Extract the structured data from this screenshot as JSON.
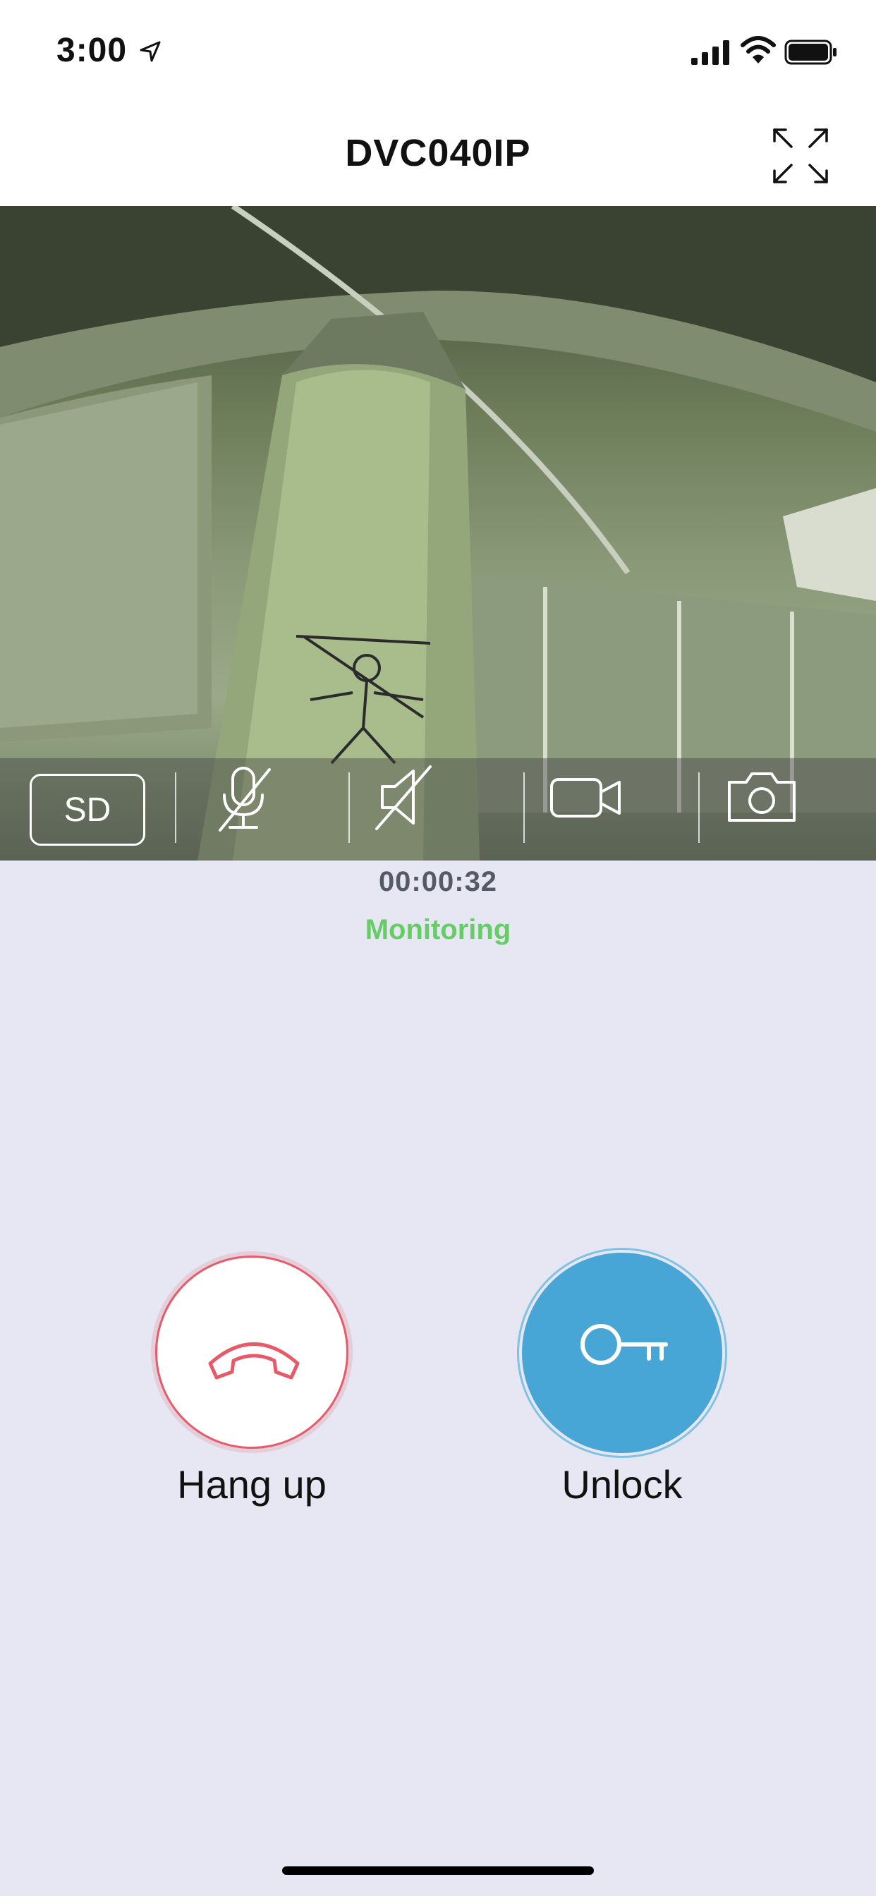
{
  "status_bar": {
    "time": "3:00",
    "icons": [
      "location-arrow-icon",
      "cellular-signal-icon",
      "wifi-icon",
      "battery-icon"
    ]
  },
  "header": {
    "title": "DVC040IP",
    "fullscreen_icon": "expand-icon"
  },
  "video": {
    "description_icon": "camera-feed",
    "toolbar": {
      "resolution_label": "SD",
      "mic_icon": "microphone-muted-icon",
      "speaker_icon": "speaker-muted-icon",
      "record_icon": "video-camera-icon",
      "snapshot_icon": "camera-icon"
    }
  },
  "call": {
    "duration": "00:00:32",
    "status": "Monitoring"
  },
  "actions": {
    "hangup_label": "Hang up",
    "unlock_label": "Unlock"
  },
  "colors": {
    "background": "#e6e7f2",
    "status_green": "#66cc66",
    "hangup_red": "#e65a6a",
    "unlock_blue": "#47a6d6"
  }
}
